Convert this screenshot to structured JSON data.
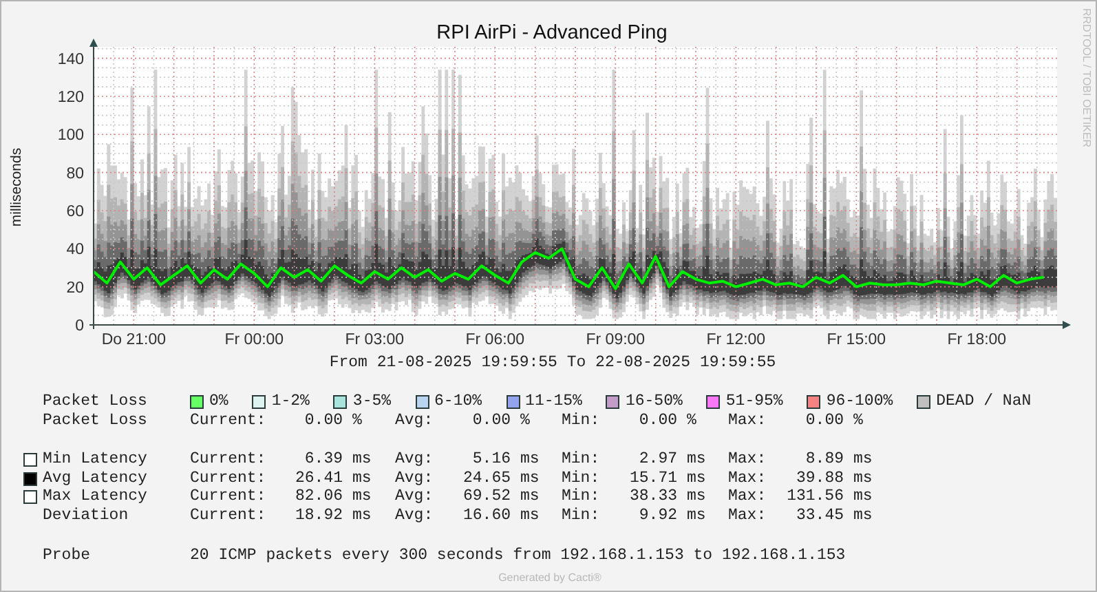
{
  "graph": {
    "side_credit": "RRDTOOL / TOBI OETIKER",
    "chart_data": {
      "type": "line",
      "title": "RPI AirPi - Advanced Ping",
      "ylabel": "milliseconds",
      "categories": [
        null,
        null,
        null,
        "Do 21:00",
        null,
        null,
        null,
        null,
        null,
        null,
        null,
        null,
        "Fr 00:00",
        null,
        null,
        null,
        null,
        null,
        null,
        null,
        null,
        "Fr 03:00",
        null,
        null,
        null,
        null,
        null,
        null,
        null,
        null,
        "Fr 06:00",
        null,
        null,
        null,
        null,
        null,
        null,
        null,
        null,
        "Fr 09:00",
        null,
        null,
        null,
        null,
        null,
        null,
        null,
        null,
        "Fr 12:00",
        null,
        null,
        null,
        null,
        null,
        null,
        null,
        null,
        "Fr 15:00",
        null,
        null,
        null,
        null,
        null,
        null,
        null,
        null,
        "Fr 18:00",
        null,
        null,
        null,
        null,
        null
      ],
      "series": [
        {
          "color": "#00ee00",
          "values": [
            28,
            22,
            33,
            24,
            30,
            21,
            26,
            31,
            22,
            29,
            24,
            32,
            27,
            20,
            30,
            25,
            29,
            23,
            31,
            26,
            22,
            28,
            24,
            30,
            25,
            29,
            23,
            27,
            24,
            31,
            26,
            22,
            33,
            38,
            35,
            40,
            24,
            20,
            30,
            19,
            32,
            22,
            36,
            20,
            28,
            24,
            22,
            23,
            20,
            22,
            24,
            21,
            22,
            20,
            25,
            22,
            26,
            20,
            22,
            21,
            21,
            22,
            21,
            23,
            22,
            21,
            24,
            20,
            26,
            22,
            24,
            25
          ]
        }
      ],
      "ylim": [
        0,
        146
      ],
      "grid": true,
      "yticks": [
        0,
        20,
        40,
        60,
        80,
        100,
        120,
        140
      ]
    }
  },
  "legend": {
    "date_range": "From 21-08-2025 19:59:55 To 22-08-2025 19:59:55",
    "loss_scale": {
      "label": "Packet Loss",
      "items": [
        {
          "label": "0%",
          "color": "#66ff66"
        },
        {
          "label": "1-2%",
          "color": "#dcf4f0"
        },
        {
          "label": "3-5%",
          "color": "#a8e4dc"
        },
        {
          "label": "6-10%",
          "color": "#b8d4f0"
        },
        {
          "label": "11-15%",
          "color": "#94a4ec"
        },
        {
          "label": "16-50%",
          "color": "#c49cc8"
        },
        {
          "label": "51-95%",
          "color": "#f878f8"
        },
        {
          "label": "96-100%",
          "color": "#f48484"
        },
        {
          "label": "DEAD / NaN",
          "color": "#c0c0c0"
        }
      ]
    },
    "loss_stats": {
      "label": "Packet Loss",
      "cells": [
        {
          "label": "Current:",
          "value": "0.00",
          "unit": "%"
        },
        {
          "label": "Avg:",
          "value": "0.00",
          "unit": "%"
        },
        {
          "label": "Min:",
          "value": "0.00",
          "unit": "%"
        },
        {
          "label": "Max:",
          "value": "0.00",
          "unit": "%"
        }
      ]
    },
    "latency_stats": [
      {
        "label": "Min Latency",
        "color": "#ffffff",
        "cells": [
          {
            "label": "Current:",
            "value": "6.39",
            "unit": "ms"
          },
          {
            "label": "Avg:",
            "value": "5.16",
            "unit": "ms"
          },
          {
            "label": "Min:",
            "value": "2.97",
            "unit": "ms"
          },
          {
            "label": "Max:",
            "value": "8.89",
            "unit": "ms"
          }
        ]
      },
      {
        "label": "Avg Latency",
        "color": "#000000",
        "cells": [
          {
            "label": "Current:",
            "value": "26.41",
            "unit": "ms"
          },
          {
            "label": "Avg:",
            "value": "24.65",
            "unit": "ms"
          },
          {
            "label": "Min:",
            "value": "15.71",
            "unit": "ms"
          },
          {
            "label": "Max:",
            "value": "39.88",
            "unit": "ms"
          }
        ]
      },
      {
        "label": "Max Latency",
        "color": "#ffffff",
        "cells": [
          {
            "label": "Current:",
            "value": "82.06",
            "unit": "ms"
          },
          {
            "label": "Avg:",
            "value": "69.52",
            "unit": "ms"
          },
          {
            "label": "Min:",
            "value": "38.33",
            "unit": "ms"
          },
          {
            "label": "Max:",
            "value": "131.56",
            "unit": "ms"
          }
        ]
      },
      {
        "label": "Deviation",
        "cells": [
          {
            "label": "Current:",
            "value": "18.92",
            "unit": "ms"
          },
          {
            "label": "Avg:",
            "value": "16.60",
            "unit": "ms"
          },
          {
            "label": "Min:",
            "value": "9.92",
            "unit": "ms"
          },
          {
            "label": "Max:",
            "value": "33.45",
            "unit": "ms"
          }
        ]
      }
    ],
    "probe": {
      "label": "Probe",
      "text": "20 ICMP packets every 300 seconds from 192.168.1.153 to 192.168.1.153"
    },
    "footer": "Generated by Cacti®"
  }
}
